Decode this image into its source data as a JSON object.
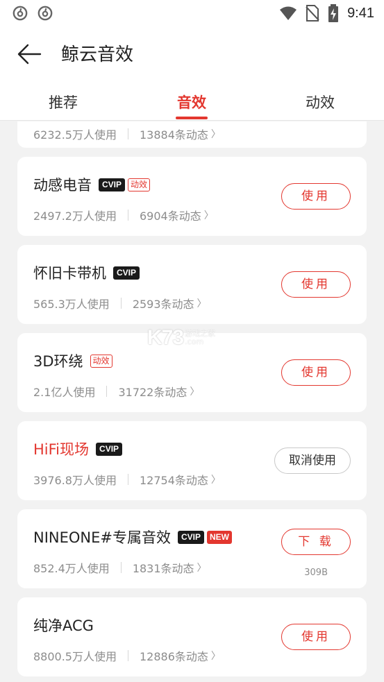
{
  "status_bar": {
    "time": "9:41",
    "left_icons": [
      "netease-music-icon",
      "netease-music-icon"
    ],
    "right_icons": [
      "wifi-icon",
      "no-sim-icon",
      "battery-charging-icon"
    ]
  },
  "header": {
    "title": "鲸云音效"
  },
  "tabs": [
    {
      "label": "推荐",
      "active": false
    },
    {
      "label": "音效",
      "active": true
    },
    {
      "label": "动效",
      "active": false
    }
  ],
  "accent_color": "#e3372f",
  "items": [
    {
      "name": "",
      "users": "6232.5万人使用",
      "posts": "13884条动态",
      "badges": [],
      "action": ""
    },
    {
      "name": "动感电音",
      "users": "2497.2万人使用",
      "posts": "6904条动态",
      "vip_badge": "VIP",
      "anim_badge": "动效",
      "action": "使用"
    },
    {
      "name": "怀旧卡带机",
      "users": "565.3万人使用",
      "posts": "2593条动态",
      "vip_badge": "VIP",
      "action": "使用"
    },
    {
      "name": "3D环绕",
      "users": "2.1亿人使用",
      "posts": "31722条动态",
      "anim_badge": "动效",
      "action": "使用"
    },
    {
      "name": "HiFi现场",
      "users": "3976.8万人使用",
      "posts": "12754条动态",
      "vip_badge": "VIP",
      "action": "取消使用",
      "active": true
    },
    {
      "name": "NINEONE#专属音效",
      "users": "852.4万人使用",
      "posts": "1831条动态",
      "vip_badge": "VIP",
      "new_badge": "NEW",
      "action": "下 载",
      "size": "309B"
    },
    {
      "name": "纯净ACG",
      "users": "8800.5万人使用",
      "posts": "12886条动态",
      "action": "使用"
    }
  ],
  "watermark": {
    "logo": "K73",
    "text_line1": "游戏之家",
    "text_line2": ".com"
  }
}
